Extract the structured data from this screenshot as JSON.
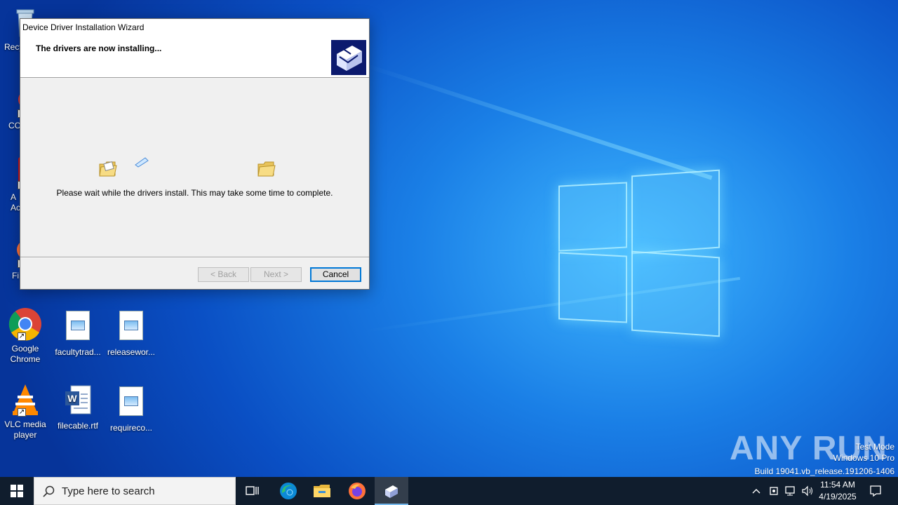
{
  "desktop": {
    "icons": [
      {
        "label": "Recy",
        "kind": "recycle"
      },
      {
        "label": "CC",
        "kind": "app"
      },
      {
        "label": "A Ac",
        "kind": "acrobat"
      },
      {
        "label": "Fi",
        "kind": "firefox"
      },
      {
        "label": "Google Chrome",
        "kind": "chrome"
      },
      {
        "label": "facultytrad...",
        "kind": "image-file"
      },
      {
        "label": "releasewor...",
        "kind": "image-file"
      },
      {
        "label": "VLC media player",
        "kind": "vlc"
      },
      {
        "label": "filecable.rtf",
        "kind": "word-file"
      },
      {
        "label": "requireco...",
        "kind": "image-file"
      }
    ]
  },
  "dialog": {
    "title": "Device Driver Installation Wizard",
    "heading": "The drivers are now installing...",
    "message": "Please wait while the drivers install. This may take some time to complete.",
    "buttons": {
      "back": "< Back",
      "next": "Next >",
      "cancel": "Cancel"
    }
  },
  "taskbar": {
    "search_placeholder": "Type here to search",
    "time": "11:54 AM",
    "date": "4/19/2025",
    "apps": [
      "task-view-icon",
      "edge-icon",
      "file-explorer-icon",
      "firefox-icon",
      "driver-wizard-icon"
    ]
  },
  "watermark": {
    "line1": "Test Mode",
    "line2": "Windows 10 Pro",
    "line3": "Build 19041.vb_release.191206-1406",
    "brand": "ANY RUN"
  },
  "colors": {
    "accent": "#0078d7",
    "taskbar": "#101d2d",
    "logo_box": "#0c1a6e"
  }
}
